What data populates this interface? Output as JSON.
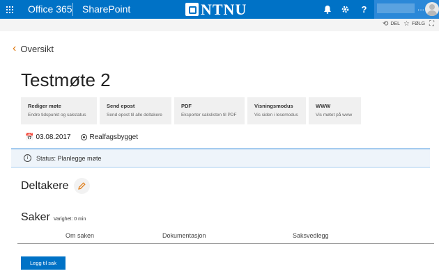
{
  "suitebar": {
    "app_launcher": "waffle-icon",
    "office": "Office 365",
    "sharepoint": "SharePoint",
    "logo_text": "NTNU",
    "bell_icon": "bell-icon",
    "gear_icon": "gear-icon",
    "help_label": "?",
    "user_ellipsis": "...",
    "accent": "#0072c6"
  },
  "commandbar": {
    "share_label": "DEL",
    "follow_label": "FØLG"
  },
  "back": {
    "label": "Oversikt"
  },
  "page": {
    "title": "Testmøte 2"
  },
  "actions": [
    {
      "title": "Rediger møte",
      "desc": "Endre tidspunkt og sakstatus"
    },
    {
      "title": "Send epost",
      "desc": "Send epost til alle deltakere"
    },
    {
      "title": "PDF",
      "desc": "Eksporter sakslisten til PDF"
    },
    {
      "title": "Visningsmodus",
      "desc": "Vis siden i lesemodus"
    },
    {
      "title": "WWW",
      "desc": "Vis møtet på www"
    }
  ],
  "meta": {
    "date": "03.08.2017",
    "location": "Realfagsbygget"
  },
  "status": {
    "text": "Status: Planlegge møte"
  },
  "participants": {
    "heading": "Deltakere"
  },
  "items": {
    "heading": "Saker",
    "duration": "Varighet: 0 min",
    "columns": [
      "Om saken",
      "Dokumentasjon",
      "Saksvedlegg"
    ],
    "add_label": "Legg til sak"
  }
}
